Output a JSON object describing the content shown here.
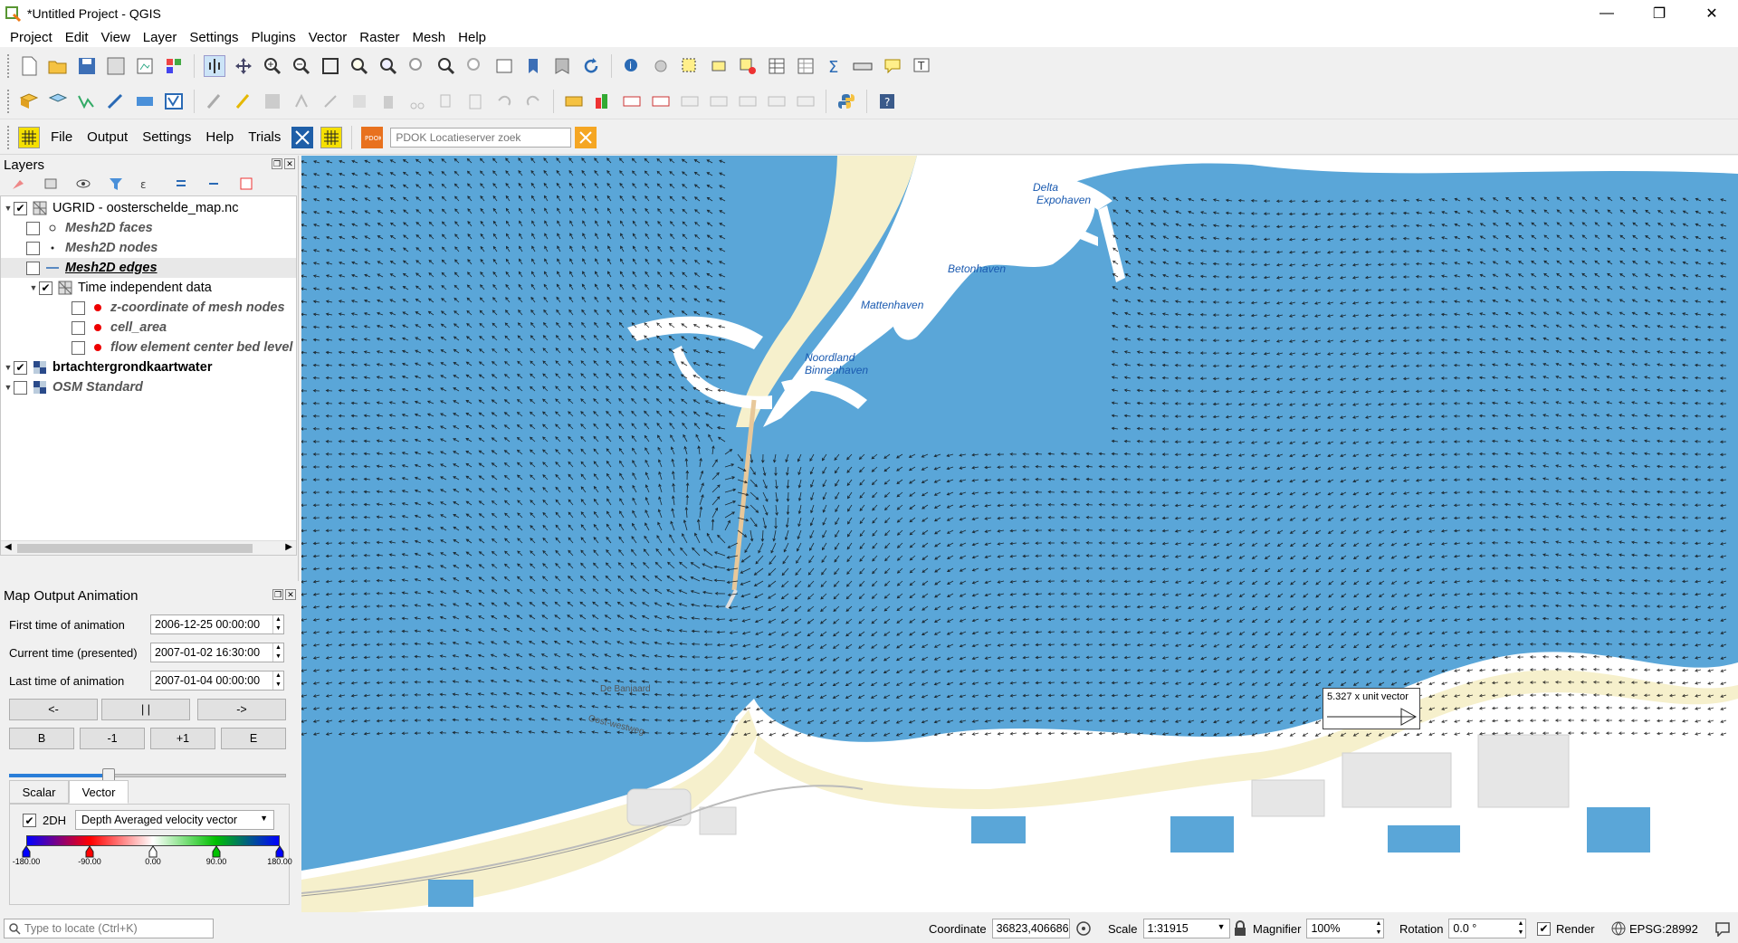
{
  "window": {
    "title": "*Untitled Project - QGIS",
    "minimize": "—",
    "maximize": "❐",
    "close": "✕"
  },
  "menu": [
    "Project",
    "Edit",
    "View",
    "Layer",
    "Settings",
    "Plugins",
    "Vector",
    "Raster",
    "Mesh",
    "Help"
  ],
  "plugin_toolbar": {
    "items": [
      "File",
      "Output",
      "Settings",
      "Help",
      "Trials"
    ],
    "pdok_placeholder": "PDOK Locatieserver zoek"
  },
  "layers_panel": {
    "title": "Layers",
    "rows": [
      {
        "label": "UGRID - oosterschelde_map.nc",
        "checked": true
      },
      {
        "label": "Mesh2D faces",
        "checked": false
      },
      {
        "label": "Mesh2D nodes",
        "checked": false
      },
      {
        "label": "Mesh2D edges",
        "checked": false
      },
      {
        "label": "Time independent data",
        "checked": true
      },
      {
        "label": "z-coordinate of mesh nodes",
        "checked": false
      },
      {
        "label": "cell_area",
        "checked": false
      },
      {
        "label": "flow element center bed level",
        "checked": false
      },
      {
        "label": "brtachtergrondkaartwater",
        "checked": true
      },
      {
        "label": "OSM Standard",
        "checked": false
      }
    ]
  },
  "animation_panel": {
    "title": "Map Output Animation",
    "first_label": "First time of animation",
    "first_value": "2006-12-25 00:00:00",
    "current_label": "Current time (presented)",
    "current_value": "2007-01-02 16:30:00",
    "last_label": "Last time of animation",
    "last_value": "2007-01-04 00:00:00",
    "btn_prev": "<-",
    "btn_pause": "| |",
    "btn_next": "->",
    "btn_begin": "B",
    "btn_minus": "-1",
    "btn_plus": "+1",
    "btn_end": "E",
    "slider_fraction": 0.36,
    "tab_scalar": "Scalar",
    "tab_vector": "Vector",
    "vec_checkbox": "2DH",
    "vec_variable": "Depth Averaged velocity vector",
    "ticks": [
      "-180.00",
      "-90.00",
      "0.00",
      "90.00",
      "180.00"
    ]
  },
  "map": {
    "labels": {
      "delta": "Delta",
      "expohaven": "Expohaven",
      "betonhaven": "Betonhaven",
      "mattenhaven": "Mattenhaven",
      "noordland": "Noordland",
      "binnenhaven": "Binnenhaven",
      "debanjaard": "De Banjaard",
      "oostwestweg": "Oost-westweg"
    },
    "legend_text": "5.327 x unit vector"
  },
  "statusbar": {
    "locate_placeholder": "Type to locate (Ctrl+K)",
    "coordinate_label": "Coordinate",
    "coordinate_value": "36823,406686",
    "scale_label": "Scale",
    "scale_value": "1:31915",
    "magnifier_label": "Magnifier",
    "magnifier_value": "100%",
    "rotation_label": "Rotation",
    "rotation_value": "0.0 °",
    "render_label": "Render",
    "crs": "EPSG:28992"
  }
}
